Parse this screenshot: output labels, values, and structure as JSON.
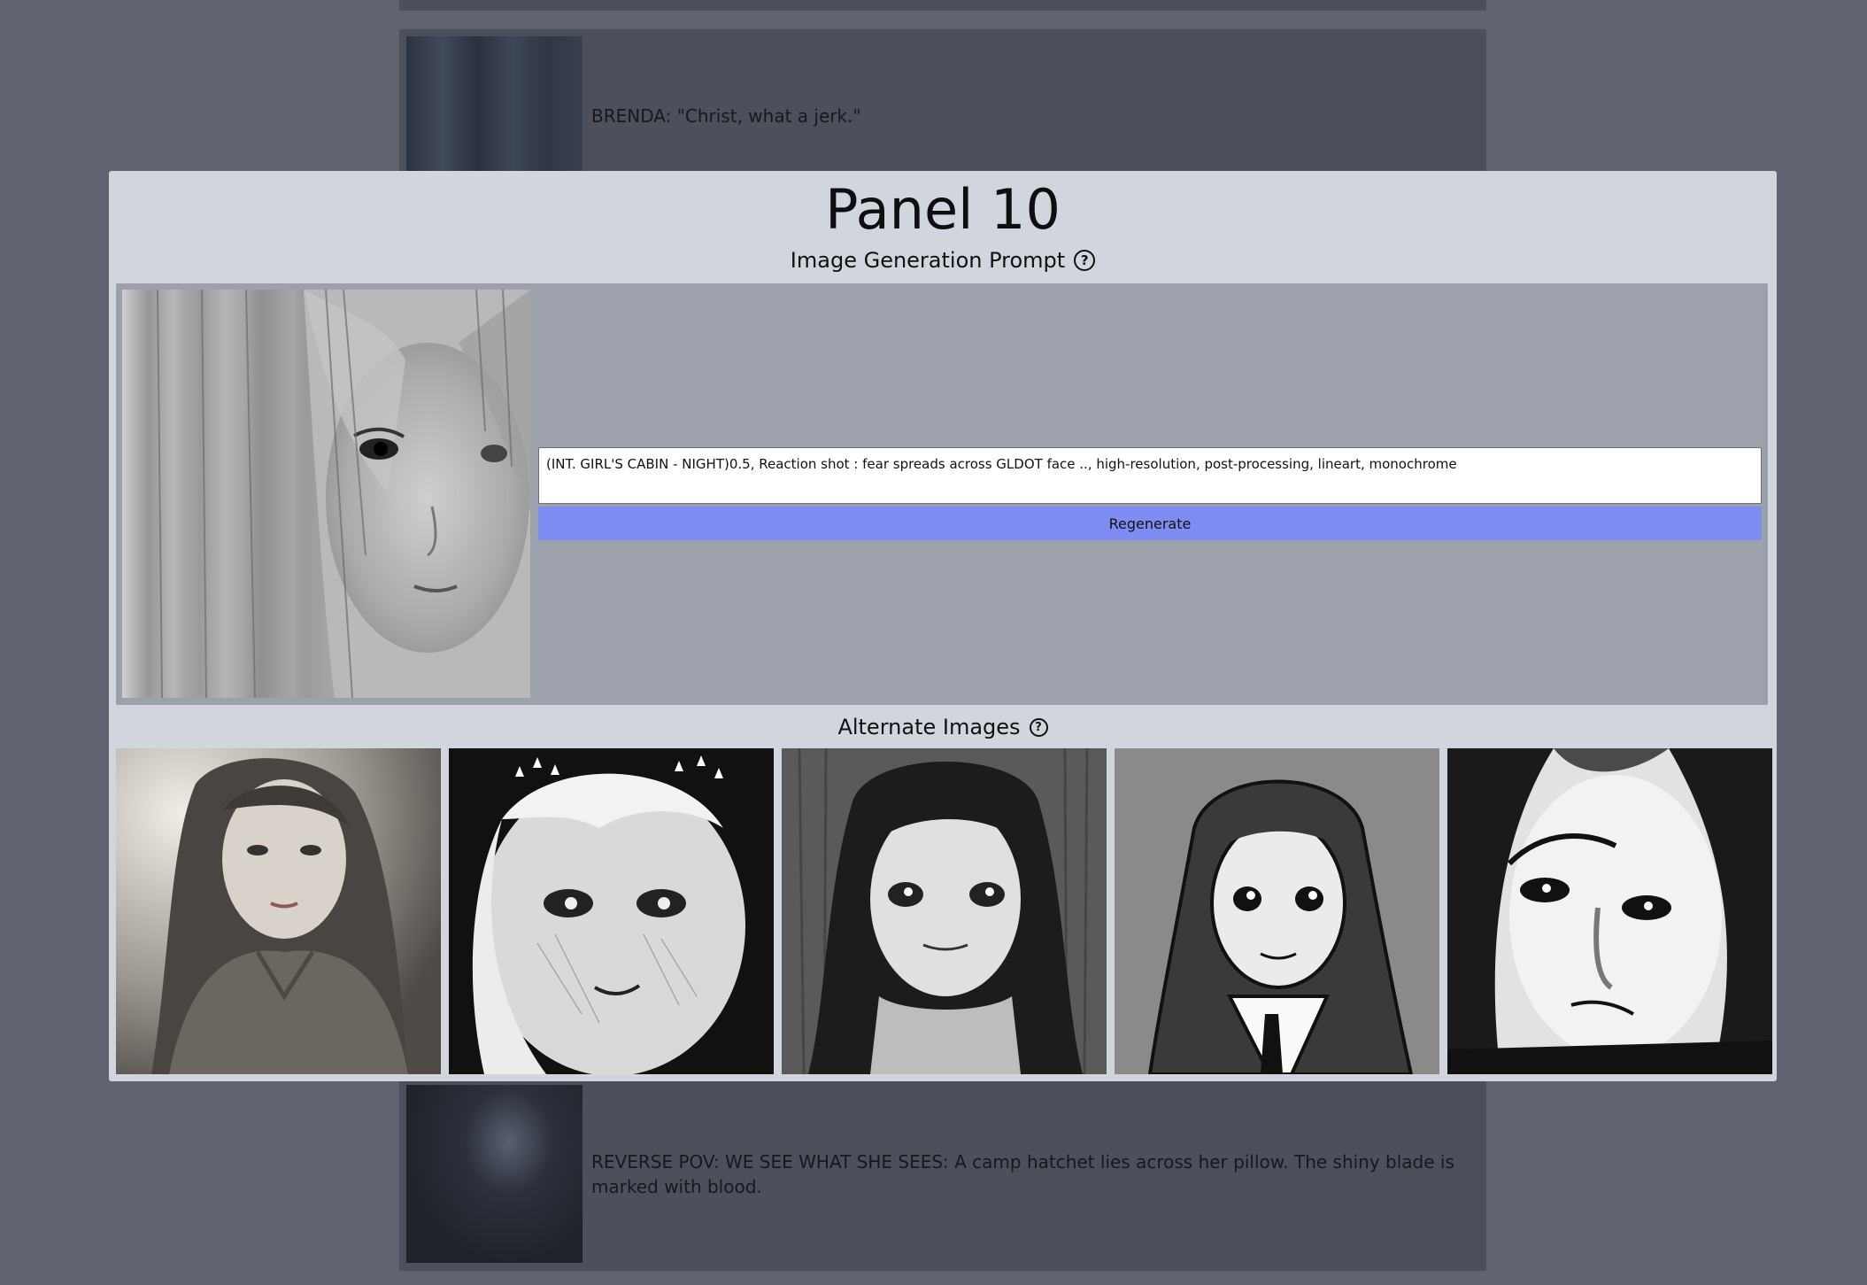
{
  "background": {
    "items": [
      {
        "caption": ""
      },
      {
        "caption": "BRENDA: \"Christ, what a jerk.\""
      },
      {
        "caption": "REVERSE POV: WE SEE WHAT SHE SEES: A camp hatchet lies across her pillow. The shiny blade is marked with blood."
      }
    ]
  },
  "modal": {
    "title": "Panel 10",
    "prompt_heading": "Image Generation Prompt",
    "prompt_value": "(INT. GIRL'S CABIN - NIGHT)0.5, Reaction shot : fear spreads across GLDOT face .., high-resolution, post-processing, lineart, monochrome",
    "regenerate_label": "Regenerate",
    "alternates_heading": "Alternate Images",
    "help_icon_glyph": "?",
    "main_image": {
      "icon": "panel-image",
      "description_colors": [
        "#b8b8b8",
        "#7a7a7a"
      ]
    },
    "alternate_images": [
      {
        "icon": "alternate-image-1"
      },
      {
        "icon": "alternate-image-2"
      },
      {
        "icon": "alternate-image-3"
      },
      {
        "icon": "alternate-image-4"
      },
      {
        "icon": "alternate-image-5"
      }
    ]
  },
  "colors": {
    "page_bg": "#5f6470",
    "card_bg": "#4b505b",
    "modal_bg": "#d1d5dd",
    "prompt_panel_bg": "#9ca1ab",
    "regenerate_bg": "#7f8cf2"
  }
}
